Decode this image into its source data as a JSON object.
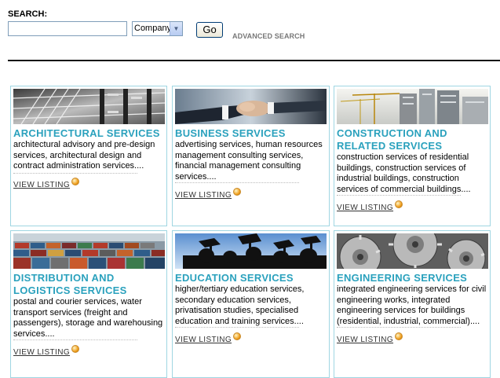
{
  "search": {
    "label": "SEARCH:",
    "value": "",
    "placeholder": "",
    "select_value": "Company",
    "go_label": "Go",
    "advanced_label": "ADVANCED SEARCH"
  },
  "colors": {
    "card_border": "#9fd6e2",
    "title": "#2aa1bd"
  },
  "cards": [
    {
      "title": "ARCHITECTURAL SERVICES",
      "description": "architectural advisory and pre-design services, architectural design and contract administration services....",
      "link": "VIEW LISTING",
      "image": "steel-structure-photo"
    },
    {
      "title": "BUSINESS SERVICES",
      "description": "advertising services, human resources management consulting services, financial management consulting services....",
      "link": "VIEW LISTING",
      "image": "handshake-photo"
    },
    {
      "title": "CONSTRUCTION AND RELATED SERVICES",
      "description": "construction services of residential buildings, construction services of industrial buildings, construction services of commercial buildings....",
      "link": "VIEW LISTING",
      "image": "cranes-skyline-photo"
    },
    {
      "title": "DISTRIBUTION AND LOGISTICS SERVICES",
      "description": "postal and courier services, water transport services (freight and passengers), storage and warehousing services....",
      "link": "VIEW LISTING",
      "image": "shipping-containers-photo"
    },
    {
      "title": "EDUCATION SERVICES",
      "description": "higher/tertiary education services, secondary education services, privatisation studies, specialised education and training services....",
      "link": "VIEW LISTING",
      "image": "graduation-caps-photo"
    },
    {
      "title": "ENGINEERING SERVICES",
      "description": "integrated engineering services for civil engineering works, integrated engineering services for buildings (residential, industrial, commercial)....",
      "link": "VIEW LISTING",
      "image": "gears-photo"
    }
  ]
}
